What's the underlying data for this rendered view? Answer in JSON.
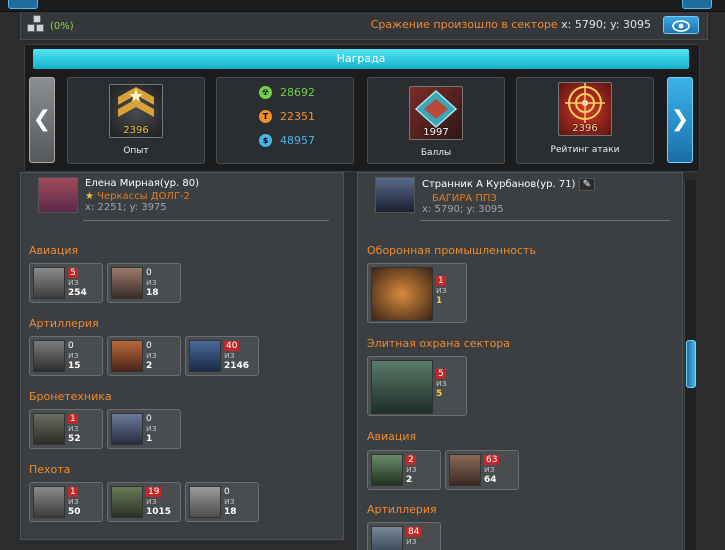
{
  "header": {
    "percent": "(0%)",
    "battle_text": "Сражение произошло в секторе",
    "battle_coords": "x: 5790; y: 3095",
    "eye_icon": "eye-icon"
  },
  "reward": {
    "title": "Награда",
    "cards": [
      {
        "label": "Опыт",
        "value": "2396"
      },
      {
        "label": "Баллы",
        "value": "1997"
      },
      {
        "label": "Рейтинг атаки",
        "value": "2396"
      }
    ],
    "resources": [
      {
        "icon": "radiation-icon",
        "value": "28692",
        "color": "#6fd24a"
      },
      {
        "icon": "titanium-icon",
        "value": "22351",
        "color": "#f0902c"
      },
      {
        "icon": "credits-icon",
        "value": "48957",
        "color": "#4ab6e8"
      }
    ]
  },
  "attacker": {
    "name": "Елена Мирная(ур. 80)",
    "corp": "Черкассы ДОЛГ-2",
    "coords": "x: 2251; y: 3975",
    "sections": [
      {
        "title": "Авиация",
        "units": [
          {
            "a": "5",
            "of": "из",
            "b": "254"
          },
          {
            "a": "0",
            "of": "из",
            "b": "18"
          }
        ]
      },
      {
        "title": "Артиллерия",
        "units": [
          {
            "a": "0",
            "of": "из",
            "b": "15"
          },
          {
            "a": "0",
            "of": "из",
            "b": "2"
          },
          {
            "a": "40",
            "of": "из",
            "b": "2146"
          }
        ]
      },
      {
        "title": "Бронетехника",
        "units": [
          {
            "a": "1",
            "of": "из",
            "b": "52"
          },
          {
            "a": "0",
            "of": "из",
            "b": "1"
          }
        ]
      },
      {
        "title": "Пехота",
        "units": [
          {
            "a": "1",
            "of": "из",
            "b": "50"
          },
          {
            "a": "19",
            "of": "из",
            "b": "1015"
          },
          {
            "a": "0",
            "of": "из",
            "b": "18"
          }
        ]
      }
    ]
  },
  "defender": {
    "name": "Странник А Курбанов(ур. 71)",
    "corp": "БАГИРА ППЗ",
    "coords": "x: 5790; y: 3095",
    "sections": [
      {
        "title": "Оборонная промышленность",
        "units": [
          {
            "a": "1",
            "of": "из",
            "b": "1"
          }
        ]
      },
      {
        "title": "Элитная охрана сектора",
        "units": [
          {
            "a": "5",
            "of": "из",
            "b": "5"
          }
        ]
      },
      {
        "title": "Авиация",
        "units": [
          {
            "a": "2",
            "of": "из",
            "b": "2"
          },
          {
            "a": "63",
            "of": "из",
            "b": "64"
          }
        ]
      },
      {
        "title": "Артиллерия",
        "units": [
          {
            "a": "84",
            "of": "из",
            "b": ""
          }
        ]
      }
    ]
  }
}
